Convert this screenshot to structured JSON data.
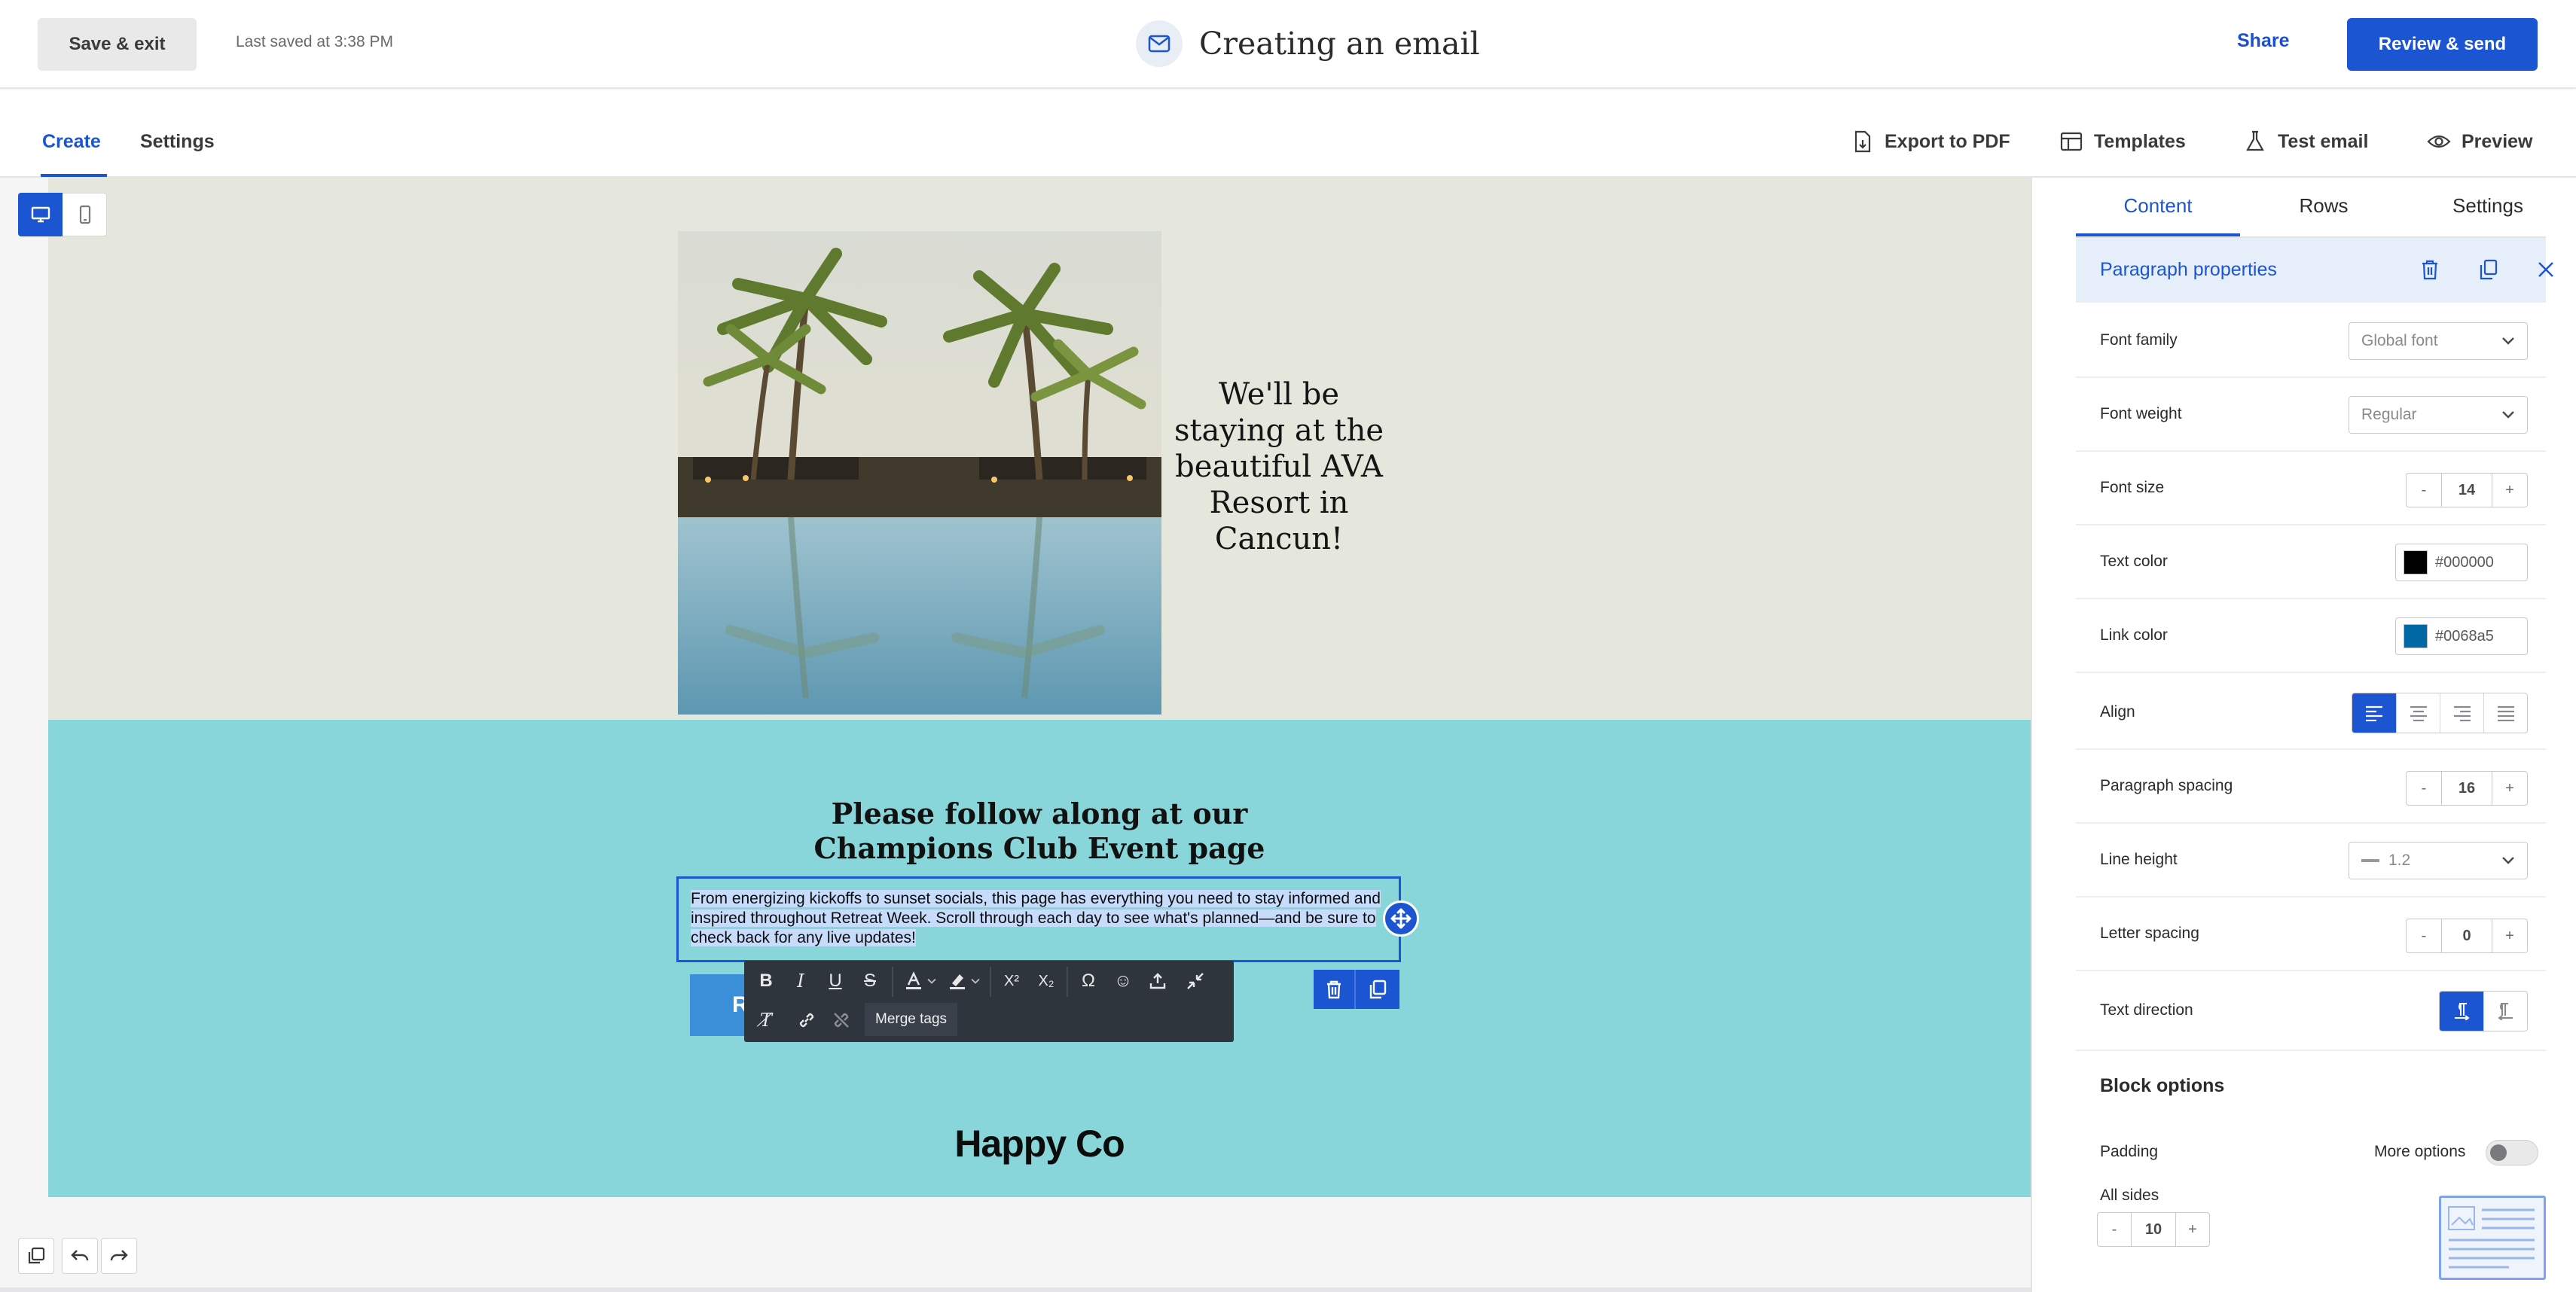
{
  "header": {
    "save_exit": "Save & exit",
    "last_saved": "Last saved at 3:38 PM",
    "title": "Creating an email",
    "share": "Share",
    "review_send": "Review & send"
  },
  "subtabs": {
    "create": "Create",
    "settings": "Settings"
  },
  "tools": {
    "export_pdf": "Export to PDF",
    "templates": "Templates",
    "test_email": "Test email",
    "preview": "Preview"
  },
  "email": {
    "resort_heading": "We'll be staying at the beautiful AVA Resort in Cancun!",
    "follow_heading": "Please follow along at our Champions Club Event page",
    "paragraph": "From energizing kickoffs to sunset socials, this page has everything you need to stay informed and inspired throughout Retreat Week. Scroll through each day to see what's planned—and be sure to check back for any live updates!",
    "button_partial": "R",
    "logo": "Happy Co"
  },
  "rte": {
    "merge_tags": "Merge tags"
  },
  "panel": {
    "tabs": {
      "content": "Content",
      "rows": "Rows",
      "settings": "Settings"
    },
    "props_title": "Paragraph properties",
    "font_family_label": "Font family",
    "font_family_value": "Global font",
    "font_weight_label": "Font weight",
    "font_weight_value": "Regular",
    "font_size_label": "Font size",
    "font_size_value": "14",
    "text_color_label": "Text color",
    "text_color_value": "#000000",
    "link_color_label": "Link color",
    "link_color_value": "#0068a5",
    "align_label": "Align",
    "paragraph_spacing_label": "Paragraph spacing",
    "paragraph_spacing_value": "16",
    "line_height_label": "Line height",
    "line_height_value": "1.2",
    "letter_spacing_label": "Letter spacing",
    "letter_spacing_value": "0",
    "text_direction_label": "Text direction",
    "block_options": "Block options",
    "padding_label": "Padding",
    "more_options": "More options",
    "all_sides_label": "All sides",
    "all_sides_value": "10",
    "stepper_minus": "-",
    "stepper_plus": "+"
  },
  "colors": {
    "accent": "#1b55d1",
    "beige_section": "#e5e7dc",
    "teal_section": "#88d6d9",
    "text_color_swatch": "#000000",
    "link_color_swatch": "#0068a5"
  },
  "icons": [
    "mail-icon",
    "export-pdf-icon",
    "templates-icon",
    "test-email-icon",
    "preview-eye-icon",
    "desktop-icon",
    "mobile-icon",
    "trash-icon",
    "copy-icon",
    "close-icon",
    "move-icon",
    "bold-icon",
    "italic-icon",
    "underline-icon",
    "strikethrough-icon",
    "text-color-icon",
    "highlight-icon",
    "superscript-icon",
    "subscript-icon",
    "special-char-icon",
    "emoji-icon",
    "upload-icon",
    "collapse-icon",
    "clear-format-icon",
    "link-icon",
    "unlink-icon",
    "undo-icon",
    "redo-icon",
    "layers-icon"
  ]
}
